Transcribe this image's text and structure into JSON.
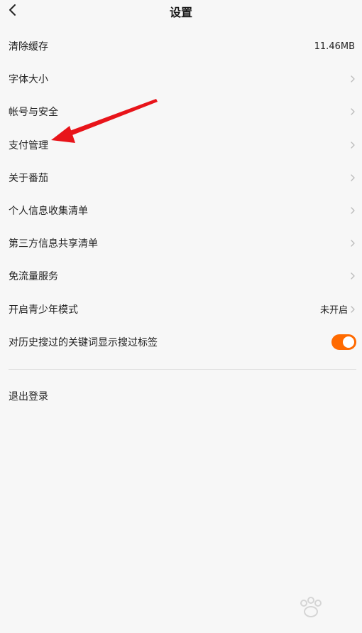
{
  "header": {
    "title": "设置"
  },
  "settings": {
    "items": [
      {
        "label": "清除缓存",
        "value": "11.46MB",
        "chevron": false
      },
      {
        "label": "字体大小",
        "value": "",
        "chevron": true
      },
      {
        "label": "帐号与安全",
        "value": "",
        "chevron": true
      },
      {
        "label": "支付管理",
        "value": "",
        "chevron": true
      },
      {
        "label": "关于番茄",
        "value": "",
        "chevron": true
      },
      {
        "label": "个人信息收集清单",
        "value": "",
        "chevron": true
      },
      {
        "label": "第三方信息共享清单",
        "value": "",
        "chevron": true
      },
      {
        "label": "免流量服务",
        "value": "",
        "chevron": true
      },
      {
        "label": "开启青少年模式",
        "value": "未开启",
        "chevron": true
      }
    ],
    "toggle_item": {
      "label": "对历史搜过的关键词显示搜过标签",
      "enabled": true
    }
  },
  "logout": {
    "label": "退出登录"
  },
  "colors": {
    "accent": "#ff6a00",
    "chevron": "#bbbbbb",
    "annotation": "#e8141a",
    "background": "#f7f7f7"
  }
}
